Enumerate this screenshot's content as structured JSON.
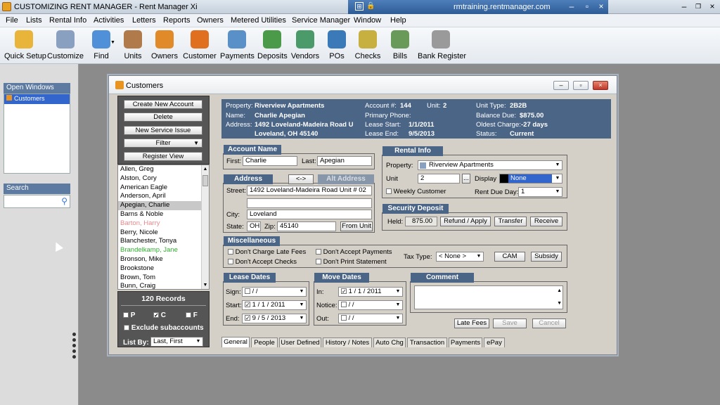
{
  "app": {
    "title": "CUSTOMIZING RENT MANAGER - Rent Manager Xi",
    "remote_host": "rmtraining.rentmanager.com"
  },
  "menu": [
    "File",
    "Lists",
    "Rental Info",
    "Activities",
    "Letters",
    "Reports",
    "Owners",
    "Metered Utilities",
    "Service Manager",
    "Window",
    "Help"
  ],
  "toolbar": [
    {
      "label": "Quick Setup",
      "icon": "clock-icon",
      "color": "#e8b43a"
    },
    {
      "label": "Customize",
      "icon": "people-gear-icon",
      "color": "#8aa0c0"
    },
    {
      "label": "Find",
      "icon": "magnifier-icon",
      "color": "#4f90d8"
    },
    {
      "label": "Units",
      "icon": "building-icon",
      "color": "#b07a4a"
    },
    {
      "label": "Owners",
      "icon": "owner-icon",
      "color": "#e08a2a"
    },
    {
      "label": "Customer",
      "icon": "customer-icon",
      "color": "#e07020"
    },
    {
      "label": "Payments",
      "icon": "globe-icon",
      "color": "#5a90c8"
    },
    {
      "label": "Deposits",
      "icon": "deposit-icon",
      "color": "#4a9a4a"
    },
    {
      "label": "Vendors",
      "icon": "vendor-icon",
      "color": "#4a9a6a"
    },
    {
      "label": "POs",
      "icon": "po-icon",
      "color": "#3a7ab8"
    },
    {
      "label": "Checks",
      "icon": "check-icon",
      "color": "#c8b040"
    },
    {
      "label": "Bills",
      "icon": "bill-icon",
      "color": "#6a9a5a"
    },
    {
      "label": "Bank Register",
      "icon": "register-icon",
      "color": "#9a9a9a"
    }
  ],
  "left_panel": {
    "open_windows_title": "Open Windows",
    "open_windows_item": "Customers",
    "search_title": "Search"
  },
  "customers": {
    "window_title": "Customers",
    "actions": {
      "create": "Create New Account",
      "delete": "Delete",
      "service": "New Service Issue",
      "filter": "Filter",
      "register": "Register View"
    },
    "names": [
      {
        "name": "Allen, Greg",
        "style": ""
      },
      {
        "name": "Alston, Cory",
        "style": ""
      },
      {
        "name": "American Eagle",
        "style": ""
      },
      {
        "name": "Anderson, April",
        "style": ""
      },
      {
        "name": "Apegian, Charlie",
        "style": "sel"
      },
      {
        "name": "Barns & Noble",
        "style": ""
      },
      {
        "name": "Barton, Harry",
        "style": "pink"
      },
      {
        "name": "Berry, Nicole",
        "style": ""
      },
      {
        "name": "Blanchester, Tonya",
        "style": ""
      },
      {
        "name": "Brandelkamp, Jane",
        "style": "green"
      },
      {
        "name": "Bronson, Mike",
        "style": ""
      },
      {
        "name": "Brookstone",
        "style": ""
      },
      {
        "name": "Brown, Tom",
        "style": ""
      },
      {
        "name": "Bunn, Craig",
        "style": ""
      }
    ],
    "records": {
      "count": "120 Records",
      "p": "P",
      "c": "C",
      "f": "F",
      "exclude": "Exclude subaccounts",
      "list_by_label": "List By:",
      "list_by_value": "Last, First"
    },
    "info": {
      "property_label": "Property:",
      "property": "Riverview Apartments",
      "name_label": "Name:",
      "name": "Charlie Apegian",
      "address_label": "Address:",
      "address1": "1492 Loveland-Madeira Road U",
      "address2": "Loveland, OH 45140",
      "account_label": "Account #:",
      "account": "144",
      "unit_label": "Unit:",
      "unit": "2",
      "primary_phone_label": "Primary Phone:",
      "lease_start_label": "Lease Start:",
      "lease_start": "1/1/2011",
      "lease_end_label": "Lease End:",
      "lease_end": "9/5/2013",
      "unit_type_label": "Unit Type:",
      "unit_type": "2B2B",
      "balance_label": "Balance Due:",
      "balance": "$875.00",
      "oldest_label": "Oldest Charge:",
      "oldest": "-27 days",
      "status_label": "Status:",
      "status": "Current"
    },
    "account_name": {
      "title": "Account Name",
      "first_label": "First:",
      "first": "Charlie",
      "last_label": "Last:",
      "last": "Apegian"
    },
    "address": {
      "title": "Address",
      "swap": "<->",
      "alt_title": "Alt Address",
      "street_label": "Street:",
      "street": "1492 Loveland-Madeira Road Unit # 02",
      "city_label": "City:",
      "city": "Loveland",
      "state_label": "State:",
      "state": "OH",
      "zip_label": "Zip:",
      "zip": "45140",
      "from_unit": "From Unit"
    },
    "rental_info": {
      "title": "Rental Info",
      "property_label": "Property:",
      "property": "Riverview Apartments",
      "unit_label": "Unit",
      "unit": "2",
      "browse": "...",
      "display_label": "Display",
      "display": "None",
      "weekly": "Weekly Customer",
      "rent_due_label": "Rent Due Day:",
      "rent_due": "1"
    },
    "security_deposit": {
      "title": "Security Deposit",
      "held_label": "Held:",
      "held": "875.00",
      "refund": "Refund / Apply",
      "transfer": "Transfer",
      "receive": "Receive"
    },
    "misc": {
      "title": "Miscellaneous",
      "late_fees": "Don't Charge Late Fees",
      "accept_payments": "Don't Accept Payments",
      "accept_checks": "Don't Accept Checks",
      "print_statement": "Don't Print Statement",
      "tax_label": "Tax Type:",
      "tax": "< None >",
      "cam": "CAM",
      "subsidy": "Subsidy"
    },
    "lease_dates": {
      "title": "Lease Dates",
      "sign_label": "Sign:",
      "sign": "  /    /",
      "start_label": "Start:",
      "start": "1 / 1 / 2011",
      "end_label": "End:",
      "end": "9 / 5 / 2013"
    },
    "move_dates": {
      "title": "Move Dates",
      "in_label": "In:",
      "in": "1 / 1 / 2011",
      "notice_label": "Notice:",
      "notice": "  /    /",
      "out_label": "Out:",
      "out": "  /    /"
    },
    "comment": {
      "title": "Comment"
    },
    "buttons": {
      "late_fees": "Late Fees",
      "save": "Save",
      "cancel": "Cancel"
    },
    "tabs": [
      "General",
      "People",
      "User Defined",
      "History / Notes",
      "Auto Chg",
      "Transaction",
      "Payments",
      "ePay"
    ]
  }
}
